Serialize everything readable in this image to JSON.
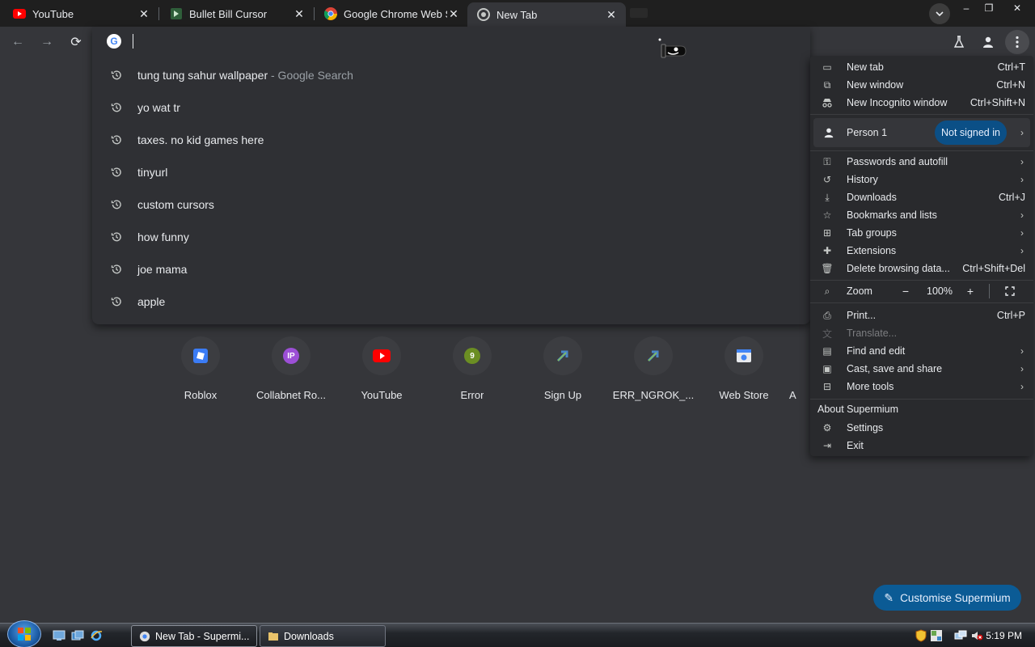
{
  "tabs": [
    {
      "title": "YouTube",
      "icon": "youtube-icon"
    },
    {
      "title": "Bullet Bill Cursor",
      "icon": "bullet-bill-icon"
    },
    {
      "title": "Google Chrome Web Store",
      "icon": "chrome-icon"
    },
    {
      "title": "New Tab",
      "icon": "chrome-icon",
      "active": true
    }
  ],
  "tab_search_icon": "chevron-down-icon",
  "window_controls": {
    "minimize": "–",
    "restore": "❐",
    "close": "✕"
  },
  "toolbar": {
    "back": "←",
    "forward": "→",
    "reload": "⟳"
  },
  "omnibox": {
    "value": "",
    "engine_icon": "G"
  },
  "suggestions": [
    {
      "text": "tung tung sahur wallpaper",
      "suffix": " - Google Search"
    },
    {
      "text": "yo wat tr",
      "suffix": ""
    },
    {
      "text": "taxes. no kid games here",
      "suffix": ""
    },
    {
      "text": "tinyurl",
      "suffix": ""
    },
    {
      "text": "custom cursors",
      "suffix": ""
    },
    {
      "text": "how funny",
      "suffix": ""
    },
    {
      "text": "joe mama",
      "suffix": ""
    },
    {
      "text": "apple",
      "suffix": ""
    }
  ],
  "shortcuts": [
    {
      "label": "Roblox",
      "icon": "roblox-icon"
    },
    {
      "label": "Collabnet Ro...",
      "icon": "ip-icon",
      "glyph": "IP"
    },
    {
      "label": "YouTube",
      "icon": "youtube-icon"
    },
    {
      "label": "Error",
      "icon": "nine-icon",
      "glyph": "9"
    },
    {
      "label": "Sign Up",
      "icon": "arrow-icon"
    },
    {
      "label": "ERR_NGROK_...",
      "icon": "arrow-icon"
    },
    {
      "label": "Web Store",
      "icon": "web-store-icon"
    },
    {
      "label": "A",
      "icon": ""
    }
  ],
  "customise_button": "Customise Supermium",
  "menu": {
    "new_tab": {
      "label": "New tab",
      "shortcut": "Ctrl+T"
    },
    "new_window": {
      "label": "New window",
      "shortcut": "Ctrl+N"
    },
    "new_incognito": {
      "label": "New Incognito window",
      "shortcut": "Ctrl+Shift+N"
    },
    "person": {
      "label": "Person 1",
      "badge": "Not signed in"
    },
    "passwords": {
      "label": "Passwords and autofill"
    },
    "history": {
      "label": "History"
    },
    "downloads": {
      "label": "Downloads",
      "shortcut": "Ctrl+J"
    },
    "bookmarks": {
      "label": "Bookmarks and lists"
    },
    "tab_groups": {
      "label": "Tab groups"
    },
    "extensions": {
      "label": "Extensions"
    },
    "delete_data": {
      "label": "Delete browsing data...",
      "shortcut": "Ctrl+Shift+Del"
    },
    "zoom": {
      "label": "Zoom",
      "minus": "−",
      "value": "100%",
      "plus": "+"
    },
    "print": {
      "label": "Print...",
      "shortcut": "Ctrl+P"
    },
    "translate": {
      "label": "Translate..."
    },
    "find_edit": {
      "label": "Find and edit"
    },
    "cast": {
      "label": "Cast, save and share"
    },
    "more_tools": {
      "label": "More tools"
    },
    "about": {
      "label": "About Supermium"
    },
    "settings": {
      "label": "Settings"
    },
    "exit": {
      "label": "Exit"
    }
  },
  "taskbar": {
    "items": [
      {
        "label": "New Tab - Supermi...",
        "active": true
      },
      {
        "label": "Downloads",
        "active": false
      }
    ],
    "clock": "5:19 PM"
  },
  "colors": {
    "accent": "#0b5b95",
    "badge": "#0b4f86",
    "background": "#35363a",
    "menu": "#292a2d"
  }
}
